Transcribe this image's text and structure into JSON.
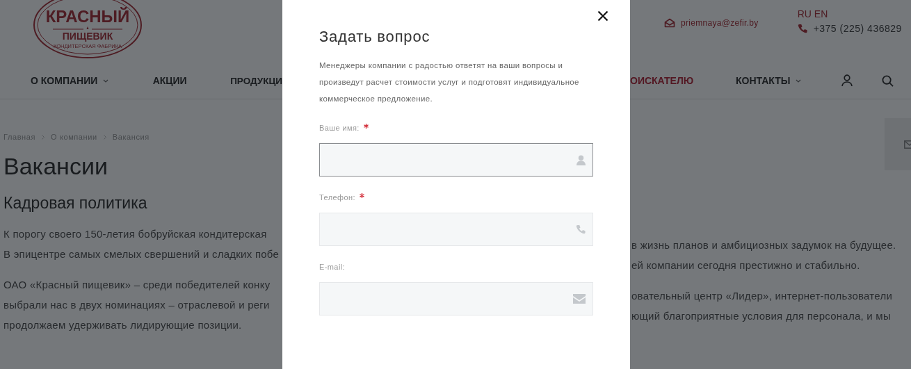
{
  "header": {
    "logo": {
      "top_line": "КРАСНЫЙ",
      "bottom_line": "ПИЩЕВИК",
      "tagline": "КОНДИТЕРСКАЯ ФАБРИКА"
    },
    "email": "priemnaya@zefir.by",
    "languages": [
      "RU",
      "EN"
    ],
    "phone": "+375 (225) 436829"
  },
  "nav_left": [
    {
      "label": "О КОМПАНИИ",
      "has_submenu": true,
      "selected": false
    },
    {
      "label": "АКЦИИ",
      "has_submenu": false,
      "selected": false
    },
    {
      "label": "ПРОДУКЦИ",
      "has_submenu": false,
      "selected": false
    }
  ],
  "nav_right": [
    {
      "label": "ОИСКАТЕЛЮ",
      "has_submenu": false,
      "selected": true
    },
    {
      "label": "КОНТАКТЫ",
      "has_submenu": true,
      "selected": false
    }
  ],
  "breadcrumb": [
    "Главная",
    "О компании",
    "Вакансия"
  ],
  "page_title": "Вакансии",
  "section_title": "Кадровая политика",
  "paragraphs": [
    {
      "lines": [
        {
          "left": "К порогу своего 150-летия бобруйская кондитерская",
          "right": "в жизнь планов и амбициозных задумок на будущее."
        },
        {
          "left": "В эпицентре самых смелых свершений и сладких побе",
          "right": "ей компании сегодня престижно и стабильно."
        }
      ]
    },
    {
      "lines": [
        {
          "left": "ОАО «Красный пищевик» – среди победителей конку",
          "right": "овательный центр «Лидер», интернет-пользователи"
        },
        {
          "left": "выбрали нас в двух номинациях – отраслевой и реги",
          "right": "ющий благоприятные условия для персонала, и мы"
        },
        {
          "left": "продолжаем удерживать лидирующие позиции."
        }
      ]
    }
  ],
  "modal": {
    "title": "Задать вопрос",
    "description": "Менеджеры компании с радостью ответят на ваши вопросы и произведут расчет стоимости услуг и подготовят индивидуальное коммерческое предложение.",
    "fields": [
      {
        "label": "Ваше имя:",
        "required": true,
        "focused": true,
        "kind": "name"
      },
      {
        "label": "Телефон:",
        "required": true,
        "focused": false,
        "kind": "phone"
      },
      {
        "label": "E-mail:",
        "required": false,
        "focused": false,
        "kind": "email"
      }
    ]
  }
}
